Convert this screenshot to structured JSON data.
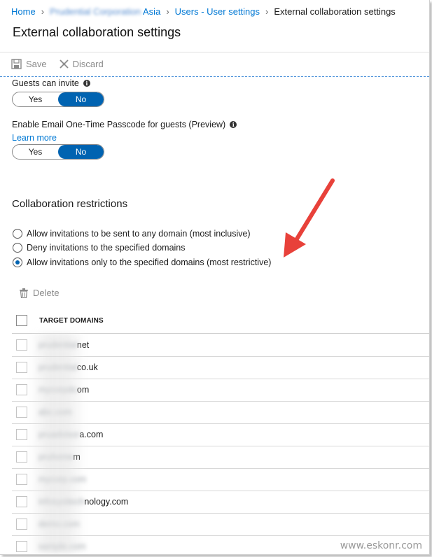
{
  "breadcrumb": {
    "home": "Home",
    "tenant_hidden": "Prudential Corporation",
    "tenant_suffix": "Asia",
    "users": "Users - User settings",
    "current": "External collaboration settings"
  },
  "page_title": "External collaboration settings",
  "toolbar": {
    "save_label": "Save",
    "discard_label": "Discard"
  },
  "settings": {
    "guests_can_invite": {
      "label": "Guests can invite",
      "yes": "Yes",
      "no": "No",
      "selected": "No"
    },
    "email_otp": {
      "label": "Enable Email One-Time Passcode for guests (Preview)",
      "learn_more": "Learn more",
      "yes": "Yes",
      "no": "No",
      "selected": "No"
    }
  },
  "collaboration": {
    "title": "Collaboration restrictions",
    "options": [
      {
        "label": "Allow invitations to be sent to any domain (most inclusive)",
        "checked": false
      },
      {
        "label": "Deny invitations to the specified domains",
        "checked": false
      },
      {
        "label": "Allow invitations only to the specified domains (most restrictive)",
        "checked": true
      }
    ]
  },
  "domains_table": {
    "delete_label": "Delete",
    "column_header": "TARGET DOMAINS",
    "rows": [
      {
        "hidden": "prudential",
        "visible": "net"
      },
      {
        "hidden": "prudential",
        "visible": "co.uk"
      },
      {
        "hidden": "mycorpdo",
        "visible": "om"
      },
      {
        "hidden": "abc.com",
        "visible": ""
      },
      {
        "hidden": "pruadvisor",
        "visible": "a.com"
      },
      {
        "hidden": "pruhome",
        "visible": "m"
      },
      {
        "hidden": "mycorp.com",
        "visible": ""
      },
      {
        "hidden": "infosysitech",
        "visible": "nology.com"
      },
      {
        "hidden": "demo.com",
        "visible": ""
      },
      {
        "hidden": "sample.com",
        "visible": ""
      }
    ]
  },
  "watermark": "www.eskonr.com",
  "colors": {
    "accent": "#0063b1",
    "link": "#0078d4",
    "arrow": "#e8413a"
  }
}
